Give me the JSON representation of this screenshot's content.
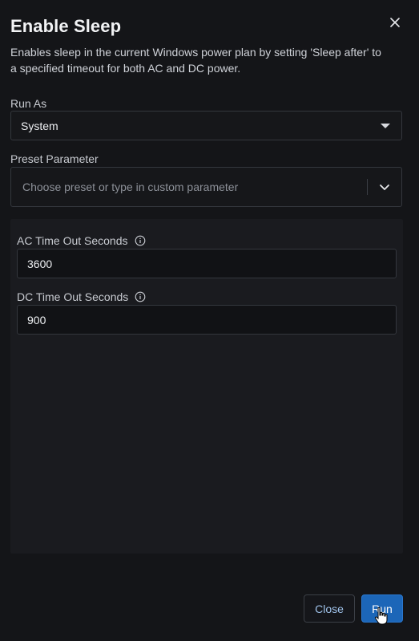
{
  "dialog": {
    "title": "Enable Sleep",
    "description": "Enables sleep in the current Windows power plan by setting 'Sleep after' to a specified timeout for both AC and DC power.",
    "close_icon": "close-icon"
  },
  "run_as": {
    "label": "Run As",
    "value": "System",
    "icon": "caret-down-icon"
  },
  "preset": {
    "label": "Preset Parameter",
    "placeholder": "Choose preset or type in custom parameter",
    "icon": "chevron-down-icon"
  },
  "parameters": [
    {
      "label": "AC Time Out Seconds",
      "value": "3600",
      "icon": "info-icon"
    },
    {
      "label": "DC Time Out Seconds",
      "value": "900",
      "icon": "info-icon"
    }
  ],
  "footer": {
    "close_label": "Close",
    "run_label": "Run"
  },
  "colors": {
    "background": "#141518",
    "panel": "#1a1b1f",
    "primary": "#1c66b8",
    "link": "#9fc2ea"
  }
}
